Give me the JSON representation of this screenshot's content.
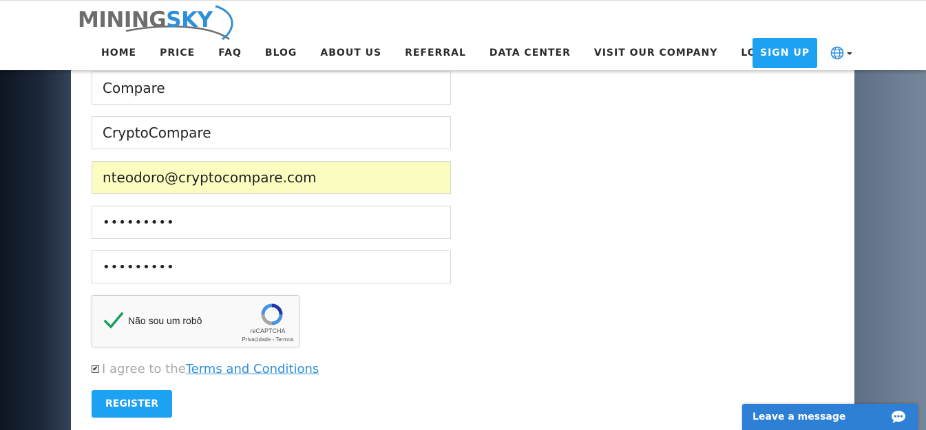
{
  "brand": {
    "part1": "MINING",
    "part2": "SKY"
  },
  "nav": {
    "items": [
      {
        "label": "HOME"
      },
      {
        "label": "PRICE"
      },
      {
        "label": "FAQ"
      },
      {
        "label": "BLOG"
      },
      {
        "label": "ABOUT US"
      },
      {
        "label": "REFERRAL"
      },
      {
        "label": "DATA CENTER"
      },
      {
        "label": "VISIT OUR COMPANY"
      },
      {
        "label": "LOGIN"
      }
    ],
    "signup_label": "SIGN UP",
    "language_icon": "globe-icon"
  },
  "form": {
    "last_name": "Compare",
    "company": "CryptoCompare",
    "email": "nteodoro@cryptocompare.com",
    "password": "•••••••••",
    "confirm_password": "•••••••••"
  },
  "recaptcha": {
    "label": "Não sou um robô",
    "brand": "reCAPTCHA",
    "links": "Privacidade - Termos",
    "checked": true
  },
  "agree": {
    "text": "I agree to the",
    "link": "Terms and Conditions",
    "checked": true
  },
  "register_label": "REGISTER",
  "chat": {
    "label": "Leave a message"
  },
  "colors": {
    "primary": "#1da1f2",
    "brand_blue": "#2f8fd8",
    "chat": "#2e7fd6",
    "autofill": "#fbfdc0",
    "check_green": "#1a9e5a"
  }
}
